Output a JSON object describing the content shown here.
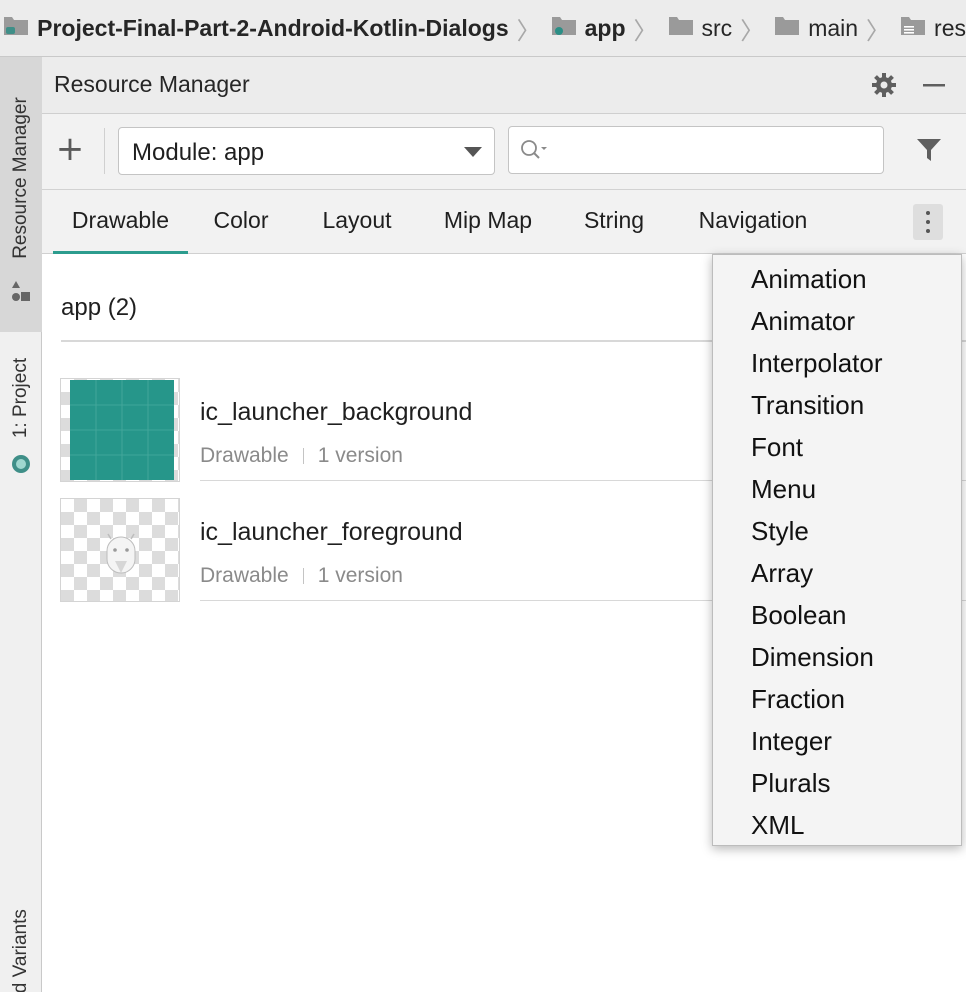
{
  "breadcrumb": {
    "items": [
      {
        "label": "Project-Final-Part-2-Android-Kotlin-Dialogs",
        "icon": "project-folder-icon",
        "bold": true
      },
      {
        "label": "app",
        "icon": "module-folder-icon",
        "bold": true
      },
      {
        "label": "src",
        "icon": "folder-icon",
        "bold": false
      },
      {
        "label": "main",
        "icon": "folder-icon",
        "bold": false
      },
      {
        "label": "res",
        "icon": "resource-folder-icon",
        "bold": false
      }
    ],
    "separator": "〉"
  },
  "tool_window_tabs": [
    {
      "label": "Resource Manager",
      "icon": "resource-manager-icon",
      "active": true
    },
    {
      "label": "1: Project",
      "icon": "android-icon",
      "active": false
    },
    {
      "label": "Build Variants",
      "active": false
    }
  ],
  "panel": {
    "title": "Resource Manager",
    "settings_icon": "gear-icon",
    "minimize_icon": "minimize-icon"
  },
  "toolbar": {
    "add_icon": "plus-icon",
    "add_label": "+",
    "module_select": {
      "value": "Module: app"
    },
    "search": {
      "value": "",
      "placeholder": ""
    },
    "filter_icon": "filter-icon"
  },
  "tabs": [
    {
      "label": "Drawable",
      "active": true
    },
    {
      "label": "Color",
      "active": false
    },
    {
      "label": "Layout",
      "active": false
    },
    {
      "label": "Mip Map",
      "active": false
    },
    {
      "label": "String",
      "active": false
    },
    {
      "label": "Navigation",
      "active": false
    }
  ],
  "more_tabs_icon": "more-vertical-icon",
  "content": {
    "group_title": "app (2)",
    "resources": [
      {
        "name": "ic_launcher_background",
        "type": "Drawable",
        "versions": "1 version",
        "preview": "teal-grid"
      },
      {
        "name": "ic_launcher_foreground",
        "type": "Drawable",
        "versions": "1 version",
        "preview": "android-head"
      }
    ]
  },
  "more_menu": {
    "items": [
      "Animation",
      "Animator",
      "Interpolator",
      "Transition",
      "Font",
      "Menu",
      "Style",
      "Array",
      "Boolean",
      "Dimension",
      "Fraction",
      "Integer",
      "Plurals",
      "XML"
    ]
  },
  "colors": {
    "accent": "#2c9c8e",
    "preview_teal": "#26968a"
  }
}
